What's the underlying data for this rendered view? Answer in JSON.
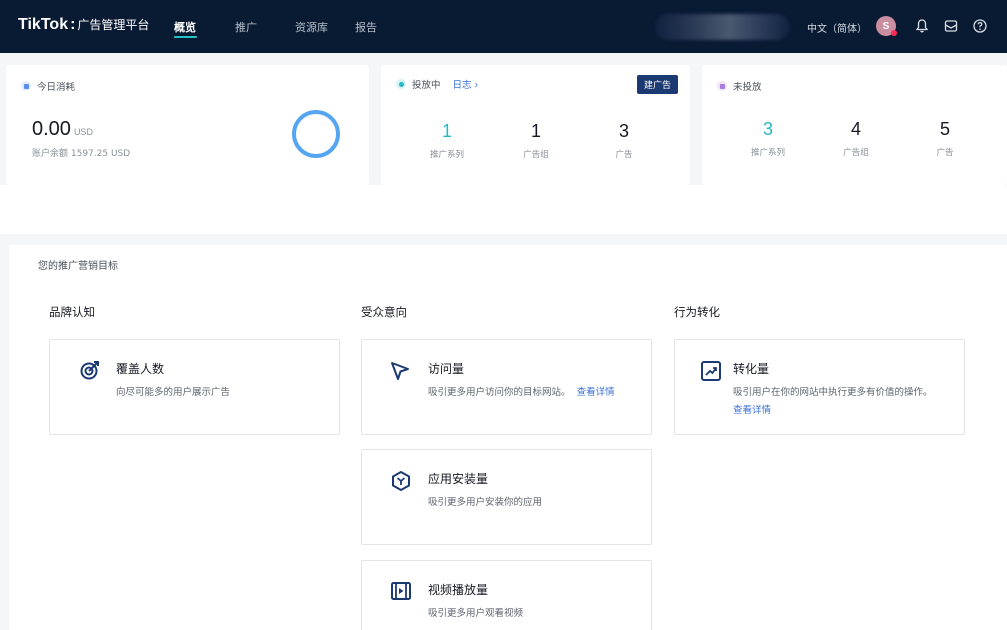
{
  "header": {
    "logo": "TikTok",
    "logo_sep": ":",
    "logo_sub": "广告管理平台",
    "nav": [
      "概览",
      "推广",
      "资源库",
      "报告"
    ],
    "language": "中文（简体）",
    "avatar_letter": "S"
  },
  "today_spend": {
    "title": "今日消耗",
    "amount": "0.00",
    "currency": "USD",
    "balance_text": "账户余额 1597.25 USD"
  },
  "active": {
    "title": "投放中",
    "log_link": "日志 ›",
    "create_button": "建广告",
    "metrics": [
      {
        "value": "1",
        "label": "推广系列"
      },
      {
        "value": "1",
        "label": "广告组"
      },
      {
        "value": "3",
        "label": "广告"
      }
    ]
  },
  "inactive": {
    "title": "未投放",
    "metrics": [
      {
        "value": "3",
        "label": "推广系列"
      },
      {
        "value": "4",
        "label": "广告组"
      },
      {
        "value": "5",
        "label": "广告"
      }
    ]
  },
  "goals": {
    "section_title": "您的推广营销目标",
    "columns": [
      {
        "title": "品牌认知",
        "items": [
          {
            "name": "覆盖人数",
            "desc": "向尽可能多的用户展示广告",
            "link": ""
          }
        ]
      },
      {
        "title": "受众意向",
        "items": [
          {
            "name": "访问量",
            "desc": "吸引更多用户访问你的目标网站。",
            "link": "查看详情"
          },
          {
            "name": "应用安装量",
            "desc": "吸引更多用户安装你的应用",
            "link": ""
          },
          {
            "name": "视频播放量",
            "desc": "吸引更多用户观看视频",
            "link": ""
          }
        ]
      },
      {
        "title": "行为转化",
        "items": [
          {
            "name": "转化量",
            "desc": "吸引用户在你的网站中执行更多有价值的操作。",
            "link": "查看详情"
          }
        ]
      }
    ]
  },
  "colors": {
    "nav_bg": "#091a33",
    "accent_teal": "#26b9c5",
    "button_navy": "#1c3a72",
    "link_blue": "#3a6fd8",
    "ring_blue": "#56a5f0"
  }
}
